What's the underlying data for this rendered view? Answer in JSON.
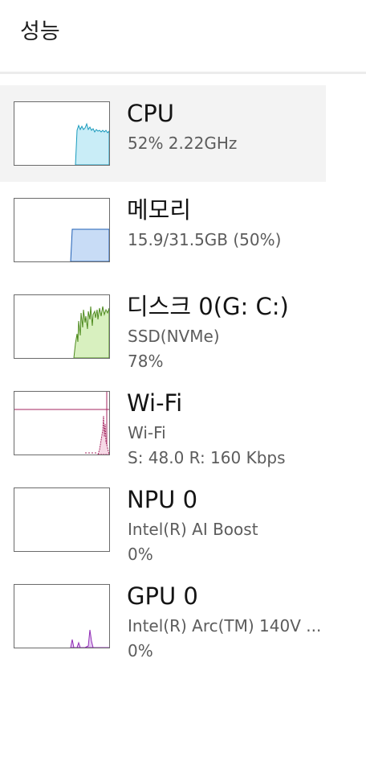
{
  "header": {
    "title": "성능"
  },
  "devices": [
    {
      "title": "CPU",
      "line1": "52%  2.22GHz",
      "line2": "",
      "selected": true,
      "graph": {
        "kind": "cpu-utilization",
        "stroke": "#1a9bbd",
        "fill": "#c9edf7",
        "recent_level_percent": 52
      }
    },
    {
      "title": "메모리",
      "line1": "15.9/31.5GB (50%)",
      "line2": "",
      "selected": false,
      "graph": {
        "kind": "memory-usage",
        "stroke": "#1f5fb5",
        "fill": "#c8dcf6",
        "recent_level_percent": 50
      }
    },
    {
      "title": "디스크 0(G: C:)",
      "line1": "SSD(NVMe)",
      "line2": "78%",
      "selected": false,
      "graph": {
        "kind": "disk-active-time",
        "stroke": "#4d8a1d",
        "fill": "#d8f0bf",
        "recent_level_percent": 78
      }
    },
    {
      "title": "Wi-Fi",
      "line1": "Wi-Fi",
      "line2": "S: 48.0  R: 160 Kbps",
      "selected": false,
      "graph": {
        "kind": "network-throughput",
        "stroke": "#a4245f",
        "fill": "#f6d9e6"
      }
    },
    {
      "title": "NPU 0",
      "line1": "Intel(R) AI Boost",
      "line2": "0%",
      "selected": false,
      "graph": {
        "kind": "npu-utilization",
        "stroke": "#8a8a8a",
        "fill": "#ffffff",
        "recent_level_percent": 0
      }
    },
    {
      "title": "GPU 0",
      "line1": "Intel(R) Arc(TM) 140V ...",
      "line2": "0%",
      "selected": false,
      "graph": {
        "kind": "gpu-utilization",
        "stroke": "#8f2bb5",
        "fill": "#e6ccf2",
        "recent_level_percent": 0
      }
    }
  ]
}
